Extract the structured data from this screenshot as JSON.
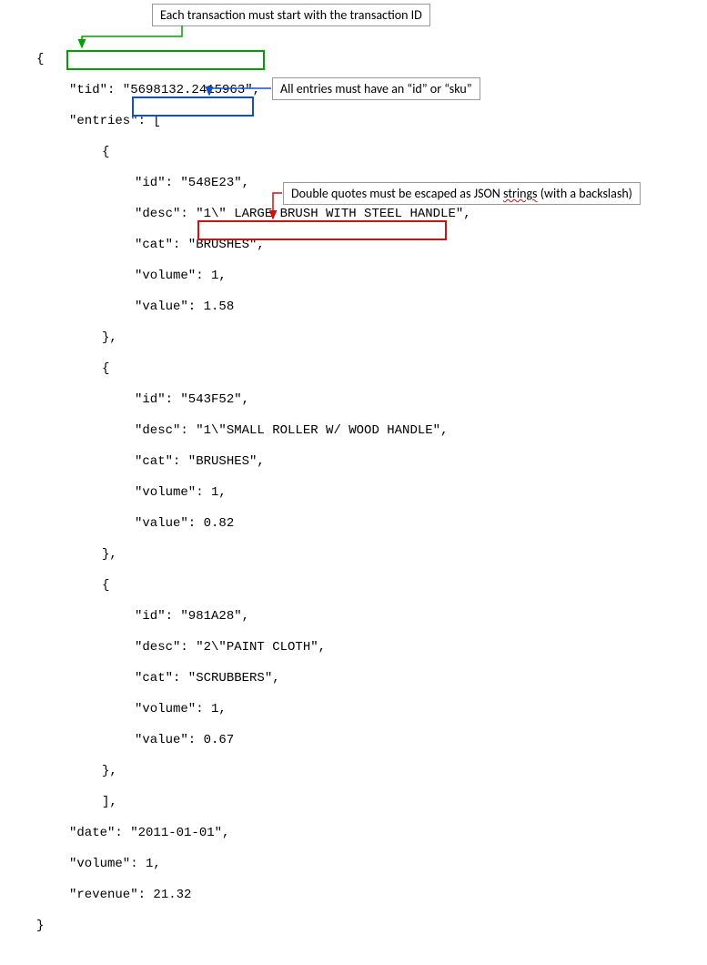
{
  "annotations": {
    "tid_note": "Each transaction must start with the transaction ID",
    "id_note": "All entries must have an “id” or “sku”",
    "escape_note_prefix": "Double quotes must be escaped as JSON ",
    "escape_note_squiggle": "strings",
    "escape_note_suffix": " (with a backslash)"
  },
  "code": {
    "l01": "{",
    "l02": "\"tid\": \"5698132.2415963\",",
    "l03": "\"entries\": [",
    "l04": "{",
    "l05": "\"id\": \"548E23\",",
    "l06": "\"desc\": \"1\\\" LARGE BRUSH WITH STEEL HANDLE\",",
    "l07": "\"cat\": \"BRUSHES\",",
    "l08": "\"volume\": 1,",
    "l09": "\"value\": 1.58",
    "l10": "},",
    "l11": "{",
    "l12": "\"id\": \"543F52\",",
    "l13_prefix": "\"desc\": ",
    "l13_value": "\"1\\\"SMALL ROLLER W/ WOOD HANDLE\",",
    "l14": "\"cat\": \"BRUSHES\",",
    "l15": "\"volume\": 1,",
    "l16": "\"value\": 0.82",
    "l17": "},",
    "l18": "{",
    "l19": "\"id\": \"981A28\",",
    "l20": "\"desc\": \"2\\\"PAINT CLOTH\",",
    "l21": "\"cat\": \"SCRUBBERS\",",
    "l22": "\"volume\": 1,",
    "l23": "\"value\": 0.67",
    "l24": "},",
    "l25": "],",
    "l26": "\"date\": \"2011-01-01\",",
    "l27": "\"volume\": 1,",
    "l28": "\"revenue\": 21.32",
    "l29": "}"
  }
}
